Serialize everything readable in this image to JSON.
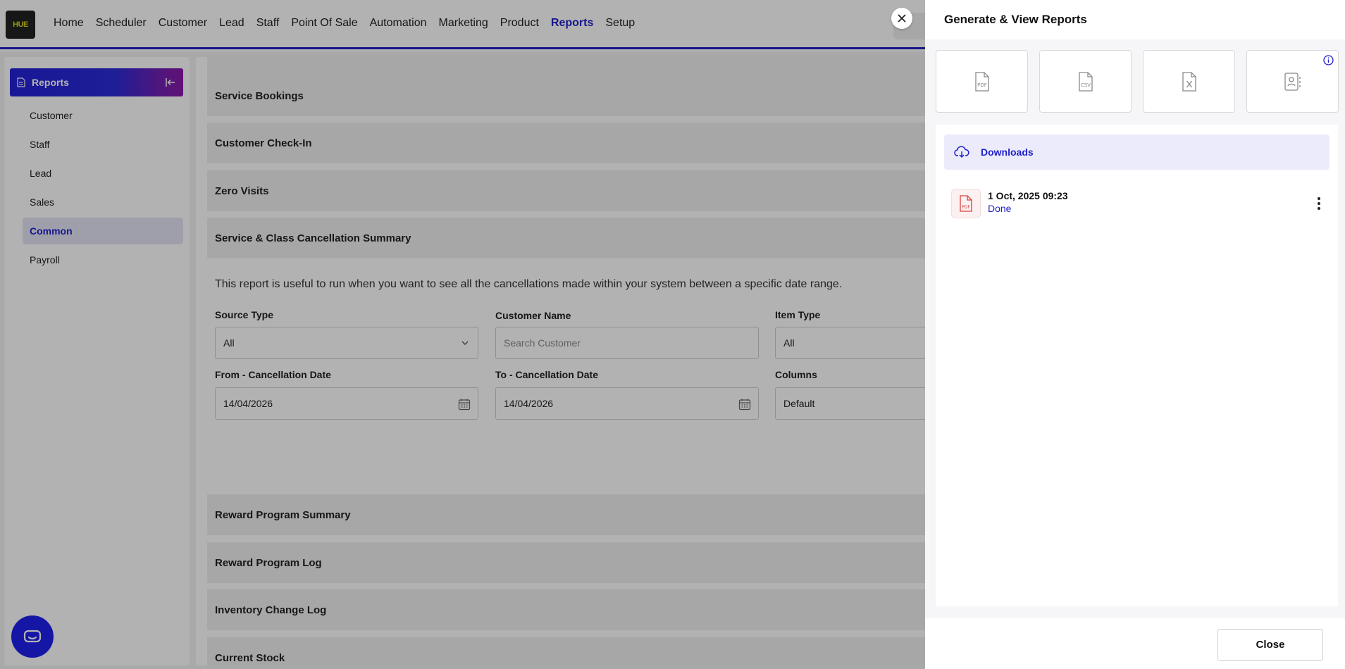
{
  "app": {
    "logo_text": "HUE"
  },
  "nav": {
    "items": [
      "Home",
      "Scheduler",
      "Customer",
      "Lead",
      "Staff",
      "Point Of Sale",
      "Automation",
      "Marketing",
      "Product",
      "Reports",
      "Setup"
    ],
    "active": "Reports"
  },
  "sidebar": {
    "title": "Reports",
    "items": [
      "Customer",
      "Staff",
      "Lead",
      "Sales",
      "Common",
      "Payroll"
    ],
    "active": "Common"
  },
  "reports": {
    "sections_top": [
      "Service Bookings",
      "Customer Check-In",
      "Zero Visits",
      "Service & Class Cancellation Summary"
    ],
    "description": "This report is useful to run when you want to see all the cancellations made within your system between a specific date range.",
    "fields": {
      "source_type_label": "Source Type",
      "source_type_value": "All",
      "customer_name_label": "Customer Name",
      "customer_name_placeholder": "Search Customer",
      "item_type_label": "Item Type",
      "item_type_value": "All",
      "from_date_label": "From - Cancellation Date",
      "from_date_value": "14/04/2026",
      "to_date_label": "To - Cancellation Date",
      "to_date_value": "14/04/2026",
      "columns_label": "Columns",
      "columns_value": "Default"
    },
    "sections_bottom": [
      "Reward Program Summary",
      "Reward Program Log",
      "Inventory Change Log",
      "Current Stock"
    ]
  },
  "panel": {
    "title": "Generate & View Reports",
    "formats": [
      "pdf-icon",
      "csv-icon",
      "excel-icon",
      "contact-report-icon"
    ],
    "downloads_title": "Downloads",
    "downloads": [
      {
        "time": "1 Oct, 2025 09:23",
        "status": "Done"
      }
    ],
    "close_label": "Close"
  },
  "colors": {
    "accent": "#1f1fc9",
    "header_gradient_start": "#2323d8",
    "header_gradient_end": "#8a1aa8",
    "chat_bubble": "#1f1fee"
  }
}
